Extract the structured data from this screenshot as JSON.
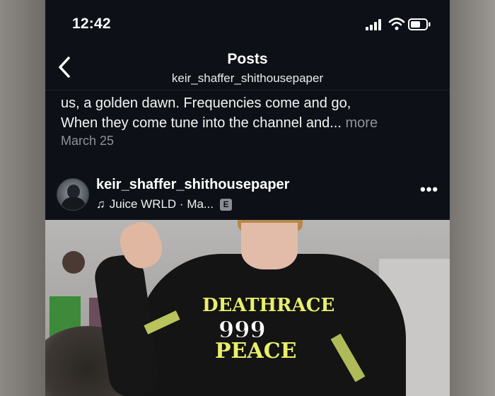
{
  "status_bar": {
    "time": "12:42"
  },
  "nav": {
    "title": "Posts",
    "subtitle": "keir_shaffer_shithousepaper"
  },
  "caption": {
    "line1": "us, a golden dawn. Frequencies come and go,",
    "line2": "When they come tune into the channel and...",
    "more": "more",
    "date": "March 25"
  },
  "post": {
    "username": "keir_shaffer_shithousepaper",
    "music": "Juice WRLD · Ma...",
    "explicit_badge": "E",
    "options_icon": "more-horizontal-icon"
  },
  "photo": {
    "print_top": "DEATHRACE",
    "print_num": "999",
    "print_bottom": "PEACE"
  },
  "colors": {
    "background": "#0d1117",
    "secondary_text": "#8e9299",
    "print_yellow": "#e8ef6a"
  }
}
